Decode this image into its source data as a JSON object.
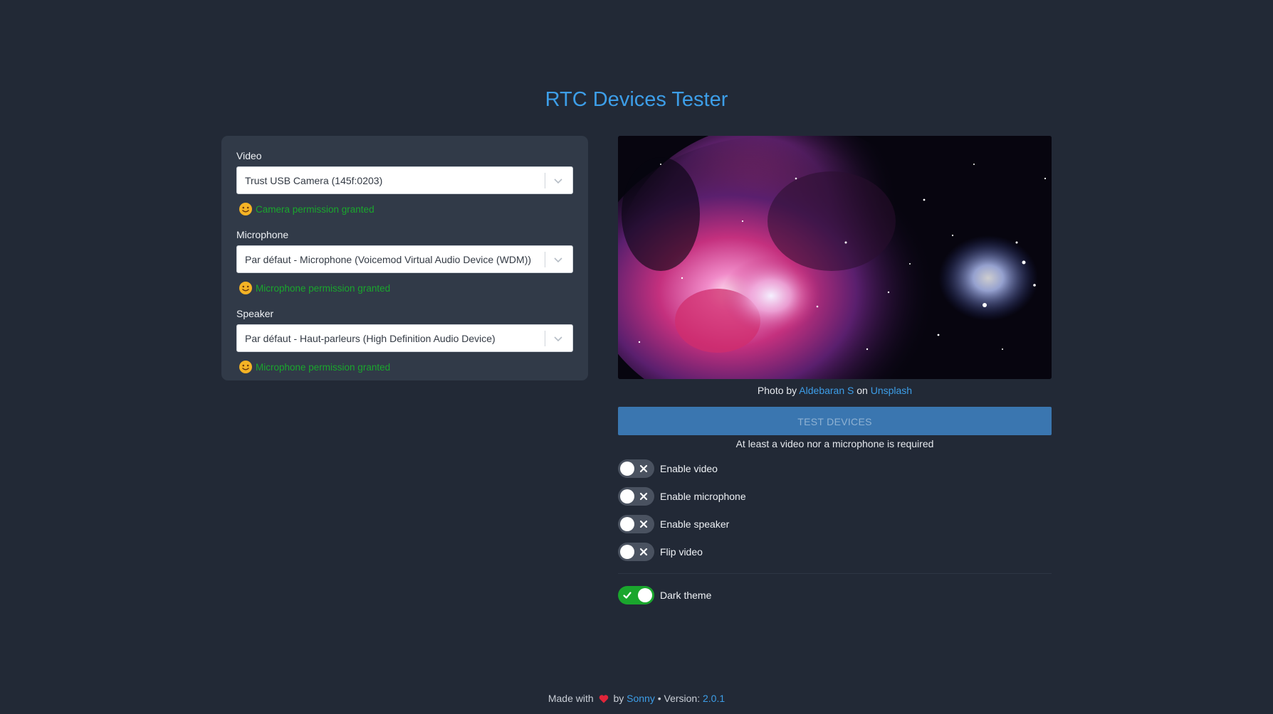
{
  "header": {
    "title": "RTC Devices Tester"
  },
  "devices": {
    "video": {
      "label": "Video",
      "selected": "Trust USB Camera (145f:0203)",
      "status": "Camera permission granted"
    },
    "microphone": {
      "label": "Microphone",
      "selected": "Par défaut - Microphone (Voicemod Virtual Audio Device (WDM))",
      "status": "Microphone permission granted"
    },
    "speaker": {
      "label": "Speaker",
      "selected": "Par défaut - Haut-parleurs (High Definition Audio Device)",
      "status": "Microphone permission granted"
    }
  },
  "preview": {
    "credit_prefix": "Photo by",
    "author": "Aldebaran S",
    "credit_middle": "on",
    "site": "Unsplash"
  },
  "actions": {
    "test_label": "TEST DEVICES",
    "hint": "At least a video nor a microphone is required"
  },
  "toggles": [
    {
      "label": "Enable video",
      "on": false
    },
    {
      "label": "Enable microphone",
      "on": false
    },
    {
      "label": "Enable speaker",
      "on": false
    },
    {
      "label": "Flip video",
      "on": false
    },
    {
      "label": "Dark theme",
      "on": true
    }
  ],
  "footer": {
    "made_with": "Made with",
    "by": "by",
    "author": "Sonny",
    "version_label": "• Version:",
    "version": "2.0.1"
  },
  "colors": {
    "background": "#222936",
    "panel": "#313a48",
    "accent": "#3d9ee8",
    "success": "#1aa62d",
    "button": "#3a76b0"
  }
}
